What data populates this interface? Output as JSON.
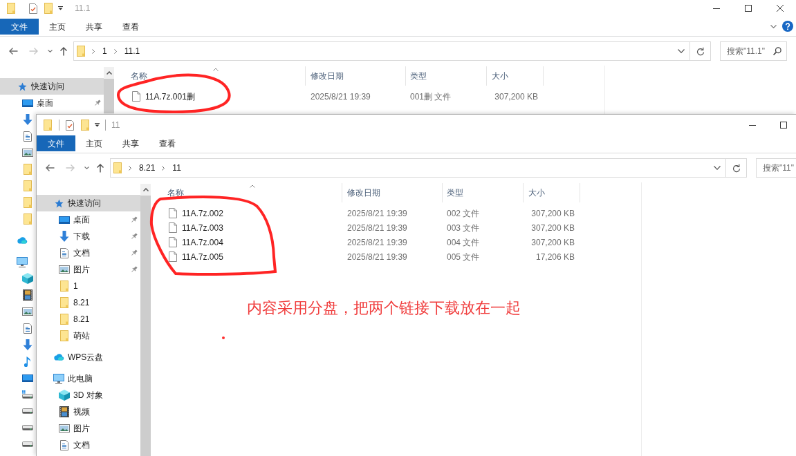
{
  "windows": [
    {
      "title": "11.1",
      "active": false,
      "ribbon_tabs": [
        {
          "kind": "file",
          "label": "文件",
          "selected": false
        },
        {
          "kind": "tab",
          "label": "主页",
          "selected": false
        },
        {
          "kind": "tab",
          "label": "共享",
          "selected": false
        },
        {
          "kind": "tab",
          "label": "查看",
          "selected": false
        }
      ],
      "address_path": [
        "1",
        "11.1"
      ],
      "search": {
        "placeholder": "搜索\"11.1\""
      },
      "navigation": [
        {
          "kind": "star",
          "label": "快速访问",
          "selected": true,
          "children": [
            {
              "kind": "desktop",
              "label": "桌面",
              "selected": false,
              "pinned": true
            },
            {
              "kind": "download"
            },
            {
              "kind": "documents"
            },
            {
              "kind": "pictures"
            },
            {
              "kind": "folder"
            },
            {
              "kind": "folder"
            },
            {
              "kind": "folder"
            },
            {
              "kind": "folder"
            }
          ]
        },
        {
          "kind": "cloud"
        },
        {
          "kind": "pc",
          "children": [
            {
              "kind": "cube"
            },
            {
              "kind": "video"
            },
            {
              "kind": "pictures"
            },
            {
              "kind": "documents"
            },
            {
              "kind": "download"
            },
            {
              "kind": "music"
            },
            {
              "kind": "desktop"
            },
            {
              "kind": "system_drive"
            },
            {
              "kind": "drive"
            },
            {
              "kind": "drive"
            },
            {
              "kind": "drive"
            }
          ]
        }
      ],
      "columns": [
        "名称",
        "修改日期",
        "类型",
        "大小"
      ],
      "files": [
        {
          "name": "11A.7z.001删",
          "modified": "2025/8/21 19:39",
          "type": "001删 文件",
          "size": "307,200 KB"
        }
      ]
    },
    {
      "title": "11",
      "active": true,
      "ribbon_tabs": [
        {
          "kind": "file",
          "label": "文件",
          "selected": false
        },
        {
          "kind": "tab",
          "label": "主页",
          "selected": false
        },
        {
          "kind": "tab",
          "label": "共享",
          "selected": false
        },
        {
          "kind": "tab",
          "label": "查看",
          "selected": false
        }
      ],
      "address_path": [
        "8.21",
        "11"
      ],
      "search": {
        "placeholder": "搜索\"11\""
      },
      "navigation": [
        {
          "kind": "star",
          "label": "快速访问",
          "selected": true,
          "children": [
            {
              "kind": "desktop",
              "label": "桌面",
              "selected": false,
              "pinned": true
            },
            {
              "kind": "download",
              "label": "下载",
              "selected": false,
              "pinned": true
            },
            {
              "kind": "documents",
              "label": "文档",
              "selected": false,
              "pinned": true
            },
            {
              "kind": "pictures",
              "label": "图片",
              "selected": false,
              "pinned": true
            },
            {
              "kind": "folder",
              "label": "1",
              "selected": false
            },
            {
              "kind": "folder",
              "label": "8.21",
              "selected": false
            },
            {
              "kind": "folder",
              "label": "8.21",
              "selected": false
            },
            {
              "kind": "folder",
              "label": "萌站",
              "selected": false
            }
          ]
        },
        {
          "kind": "cloud",
          "label": "WPS云盘",
          "selected": false
        },
        {
          "kind": "pc",
          "label": "此电脑",
          "selected": false,
          "children": [
            {
              "kind": "cube",
              "label": "3D 对象",
              "selected": false
            },
            {
              "kind": "video",
              "label": "视频",
              "selected": false
            },
            {
              "kind": "pictures",
              "label": "图片",
              "selected": false
            },
            {
              "kind": "documents",
              "label": "文档",
              "selected": false
            }
          ]
        }
      ],
      "columns": [
        "名称",
        "修改日期",
        "类型",
        "大小"
      ],
      "files": [
        {
          "name": "11A.7z.002",
          "modified": "2025/8/21 19:39",
          "type": "002 文件",
          "size": "307,200 KB"
        },
        {
          "name": "11A.7z.003",
          "modified": "2025/8/21 19:39",
          "type": "003 文件",
          "size": "307,200 KB"
        },
        {
          "name": "11A.7z.004",
          "modified": "2025/8/21 19:39",
          "type": "004 文件",
          "size": "307,200 KB"
        },
        {
          "name": "11A.7z.005",
          "modified": "2025/8/21 19:39",
          "type": "005 文件",
          "size": "17,206 KB"
        }
      ]
    }
  ],
  "annotation": {
    "text": "内容采用分盘，把两个链接下载放在一起"
  }
}
